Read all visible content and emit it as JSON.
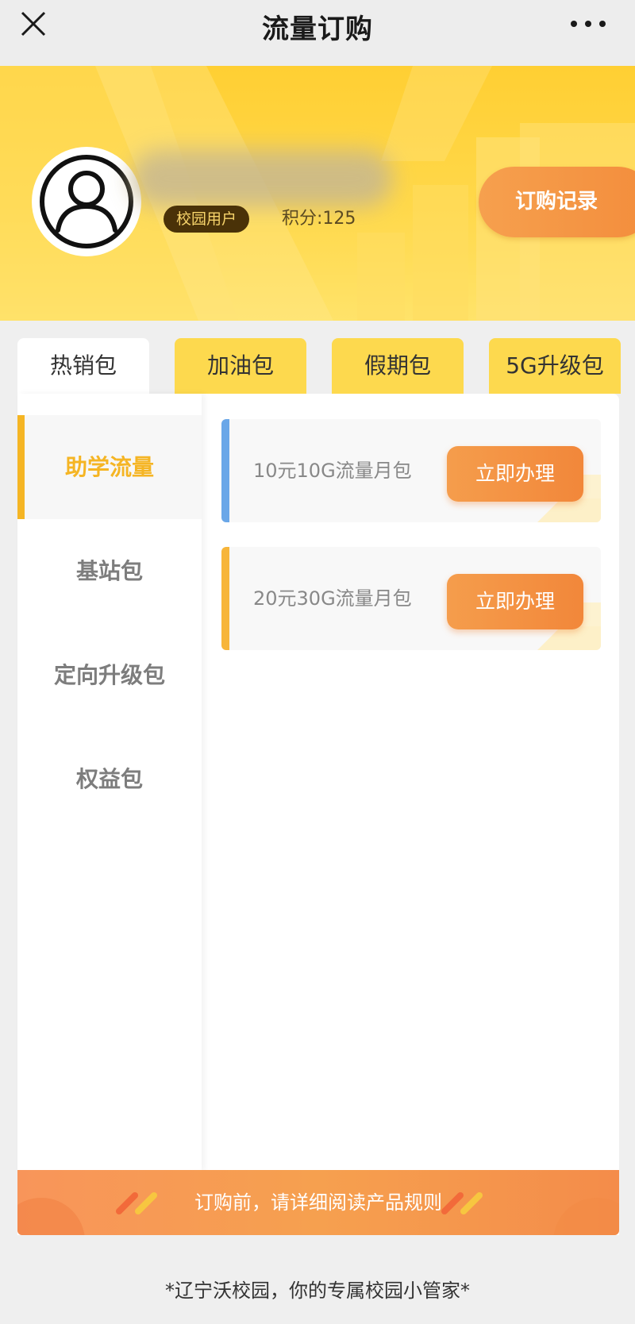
{
  "navbar": {
    "title": "流量订购"
  },
  "profile": {
    "badge": "校园用户",
    "points": "积分:125",
    "record_button": "订购记录"
  },
  "tabs": [
    {
      "label": "热销包",
      "active": true
    },
    {
      "label": "加油包",
      "active": false
    },
    {
      "label": "假期包",
      "active": false
    },
    {
      "label": "5G升级包",
      "active": false
    }
  ],
  "sidebar": {
    "items": [
      {
        "label": "助学流量",
        "active": true
      },
      {
        "label": "基站包",
        "active": false
      },
      {
        "label": "定向升级包",
        "active": false
      },
      {
        "label": "权益包",
        "active": false
      }
    ]
  },
  "packages": [
    {
      "name": "10元10G流量月包",
      "button": "立即办理",
      "stripe_color": "#6aa7e8"
    },
    {
      "name": "20元30G流量月包",
      "button": "立即办理",
      "stripe_color": "#f7b53a"
    }
  ],
  "notice": {
    "text": "订购前，请详细阅读产品规则"
  },
  "footer": {
    "text": "*辽宁沃校园，你的专属校园小管家*"
  },
  "colors": {
    "accent": "#f5b524",
    "button": "#f2873a",
    "banner": "#ffd84a"
  }
}
